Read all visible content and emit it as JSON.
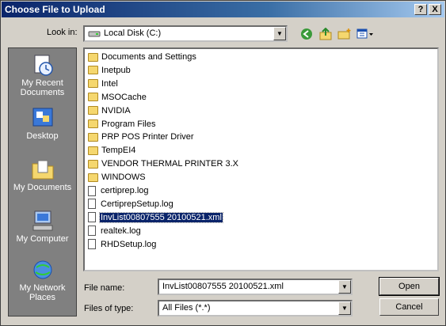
{
  "window": {
    "title": "Choose File to Upload",
    "help_button": "?",
    "close_button": "X"
  },
  "toolbar": {
    "look_in_label": "Look in:",
    "look_in_value": "Local Disk (C:)",
    "icons": [
      "back-icon",
      "up-folder-icon",
      "new-folder-icon",
      "view-menu-icon"
    ]
  },
  "places": [
    {
      "label": "My Recent Documents",
      "icon": "recent-documents-icon"
    },
    {
      "label": "Desktop",
      "icon": "desktop-icon"
    },
    {
      "label": "My Documents",
      "icon": "my-documents-icon"
    },
    {
      "label": "My Computer",
      "icon": "my-computer-icon"
    },
    {
      "label": "My Network Places",
      "icon": "network-places-icon"
    }
  ],
  "files": [
    {
      "name": "Documents and Settings",
      "type": "folder"
    },
    {
      "name": "Inetpub",
      "type": "folder"
    },
    {
      "name": "Intel",
      "type": "folder"
    },
    {
      "name": "MSOCache",
      "type": "folder"
    },
    {
      "name": "NVIDIA",
      "type": "folder"
    },
    {
      "name": "Program Files",
      "type": "folder"
    },
    {
      "name": "PRP POS Printer Driver",
      "type": "folder"
    },
    {
      "name": "TempEI4",
      "type": "folder"
    },
    {
      "name": "VENDOR THERMAL PRINTER 3.X",
      "type": "folder"
    },
    {
      "name": "WINDOWS",
      "type": "folder"
    },
    {
      "name": "certiprep.log",
      "type": "file"
    },
    {
      "name": "CertiprepSetup.log",
      "type": "file"
    },
    {
      "name": "InvList00807555 20100521.xml",
      "type": "file",
      "selected": true
    },
    {
      "name": "realtek.log",
      "type": "file"
    },
    {
      "name": "RHDSetup.log",
      "type": "file"
    }
  ],
  "form": {
    "file_name_label": "File name:",
    "file_name_value": "InvList00807555 20100521.xml",
    "file_type_label": "Files of type:",
    "file_type_value": "All Files (*.*)"
  },
  "buttons": {
    "open": "Open",
    "cancel": "Cancel"
  }
}
